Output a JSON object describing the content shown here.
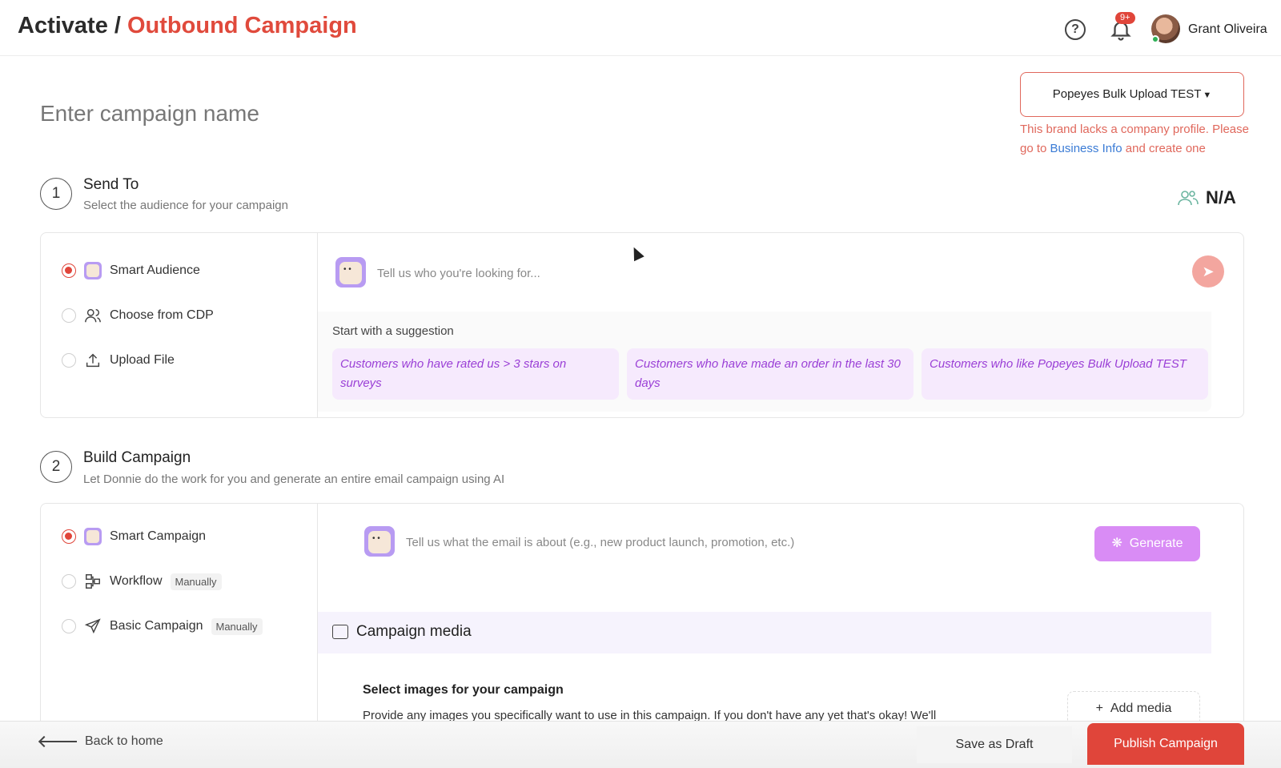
{
  "header": {
    "breadcrumb_root": "Activate",
    "breadcrumb_sep": " / ",
    "breadcrumb_current": "Outbound Campaign",
    "help_glyph": "?",
    "notifications_badge": "9+",
    "user_name": "Grant Oliveira"
  },
  "campaign": {
    "name_placeholder": "Enter campaign name"
  },
  "brand": {
    "selected": "Popeyes Bulk Upload TEST",
    "warning_line1": "This brand lacks a company profile. Please go to ",
    "warning_link": "Business Info",
    "warning_line2": " and create one",
    "audience_count": "N/A"
  },
  "step1": {
    "number": "1",
    "title": "Send To",
    "subtitle": "Select the audience for your campaign",
    "options": [
      {
        "label": "Smart Audience",
        "selected": true
      },
      {
        "label": "Choose from CDP",
        "selected": false
      },
      {
        "label": "Upload File",
        "selected": false
      }
    ],
    "prompt_placeholder": "Tell us who you're looking for...",
    "suggestion_label": "Start with a suggestion",
    "suggestions": [
      "Customers who have rated us > 3 stars on surveys",
      "Customers who have made an order in the last 30 days",
      "Customers who like Popeyes Bulk Upload TEST"
    ]
  },
  "step2": {
    "number": "2",
    "title": "Build Campaign",
    "subtitle": "Let Donnie do the work for you and generate an entire email campaign using AI",
    "options": [
      {
        "label": "Smart Campaign",
        "selected": true,
        "tag": ""
      },
      {
        "label": "Workflow",
        "selected": false,
        "tag": "Manually"
      },
      {
        "label": "Basic Campaign",
        "selected": false,
        "tag": "Manually"
      }
    ],
    "prompt_placeholder": "Tell us what the email is about (e.g., new product launch, promotion, etc.)",
    "generate_label": "Generate",
    "media_title": "Campaign media",
    "select_images_title": "Select images for your campaign",
    "select_images_desc": "Provide any images you specifically want to use in this campaign. If you don't have any yet that's okay! We'll",
    "add_media_label": "Add media"
  },
  "footer": {
    "back_label": "Back to home",
    "draft_label": "Save as Draft",
    "publish_label": "Publish Campaign"
  },
  "colors": {
    "accent_red": "#e04a3c",
    "suggestion_text": "#9a3fd6",
    "generate_bg": "#d98cf5"
  }
}
